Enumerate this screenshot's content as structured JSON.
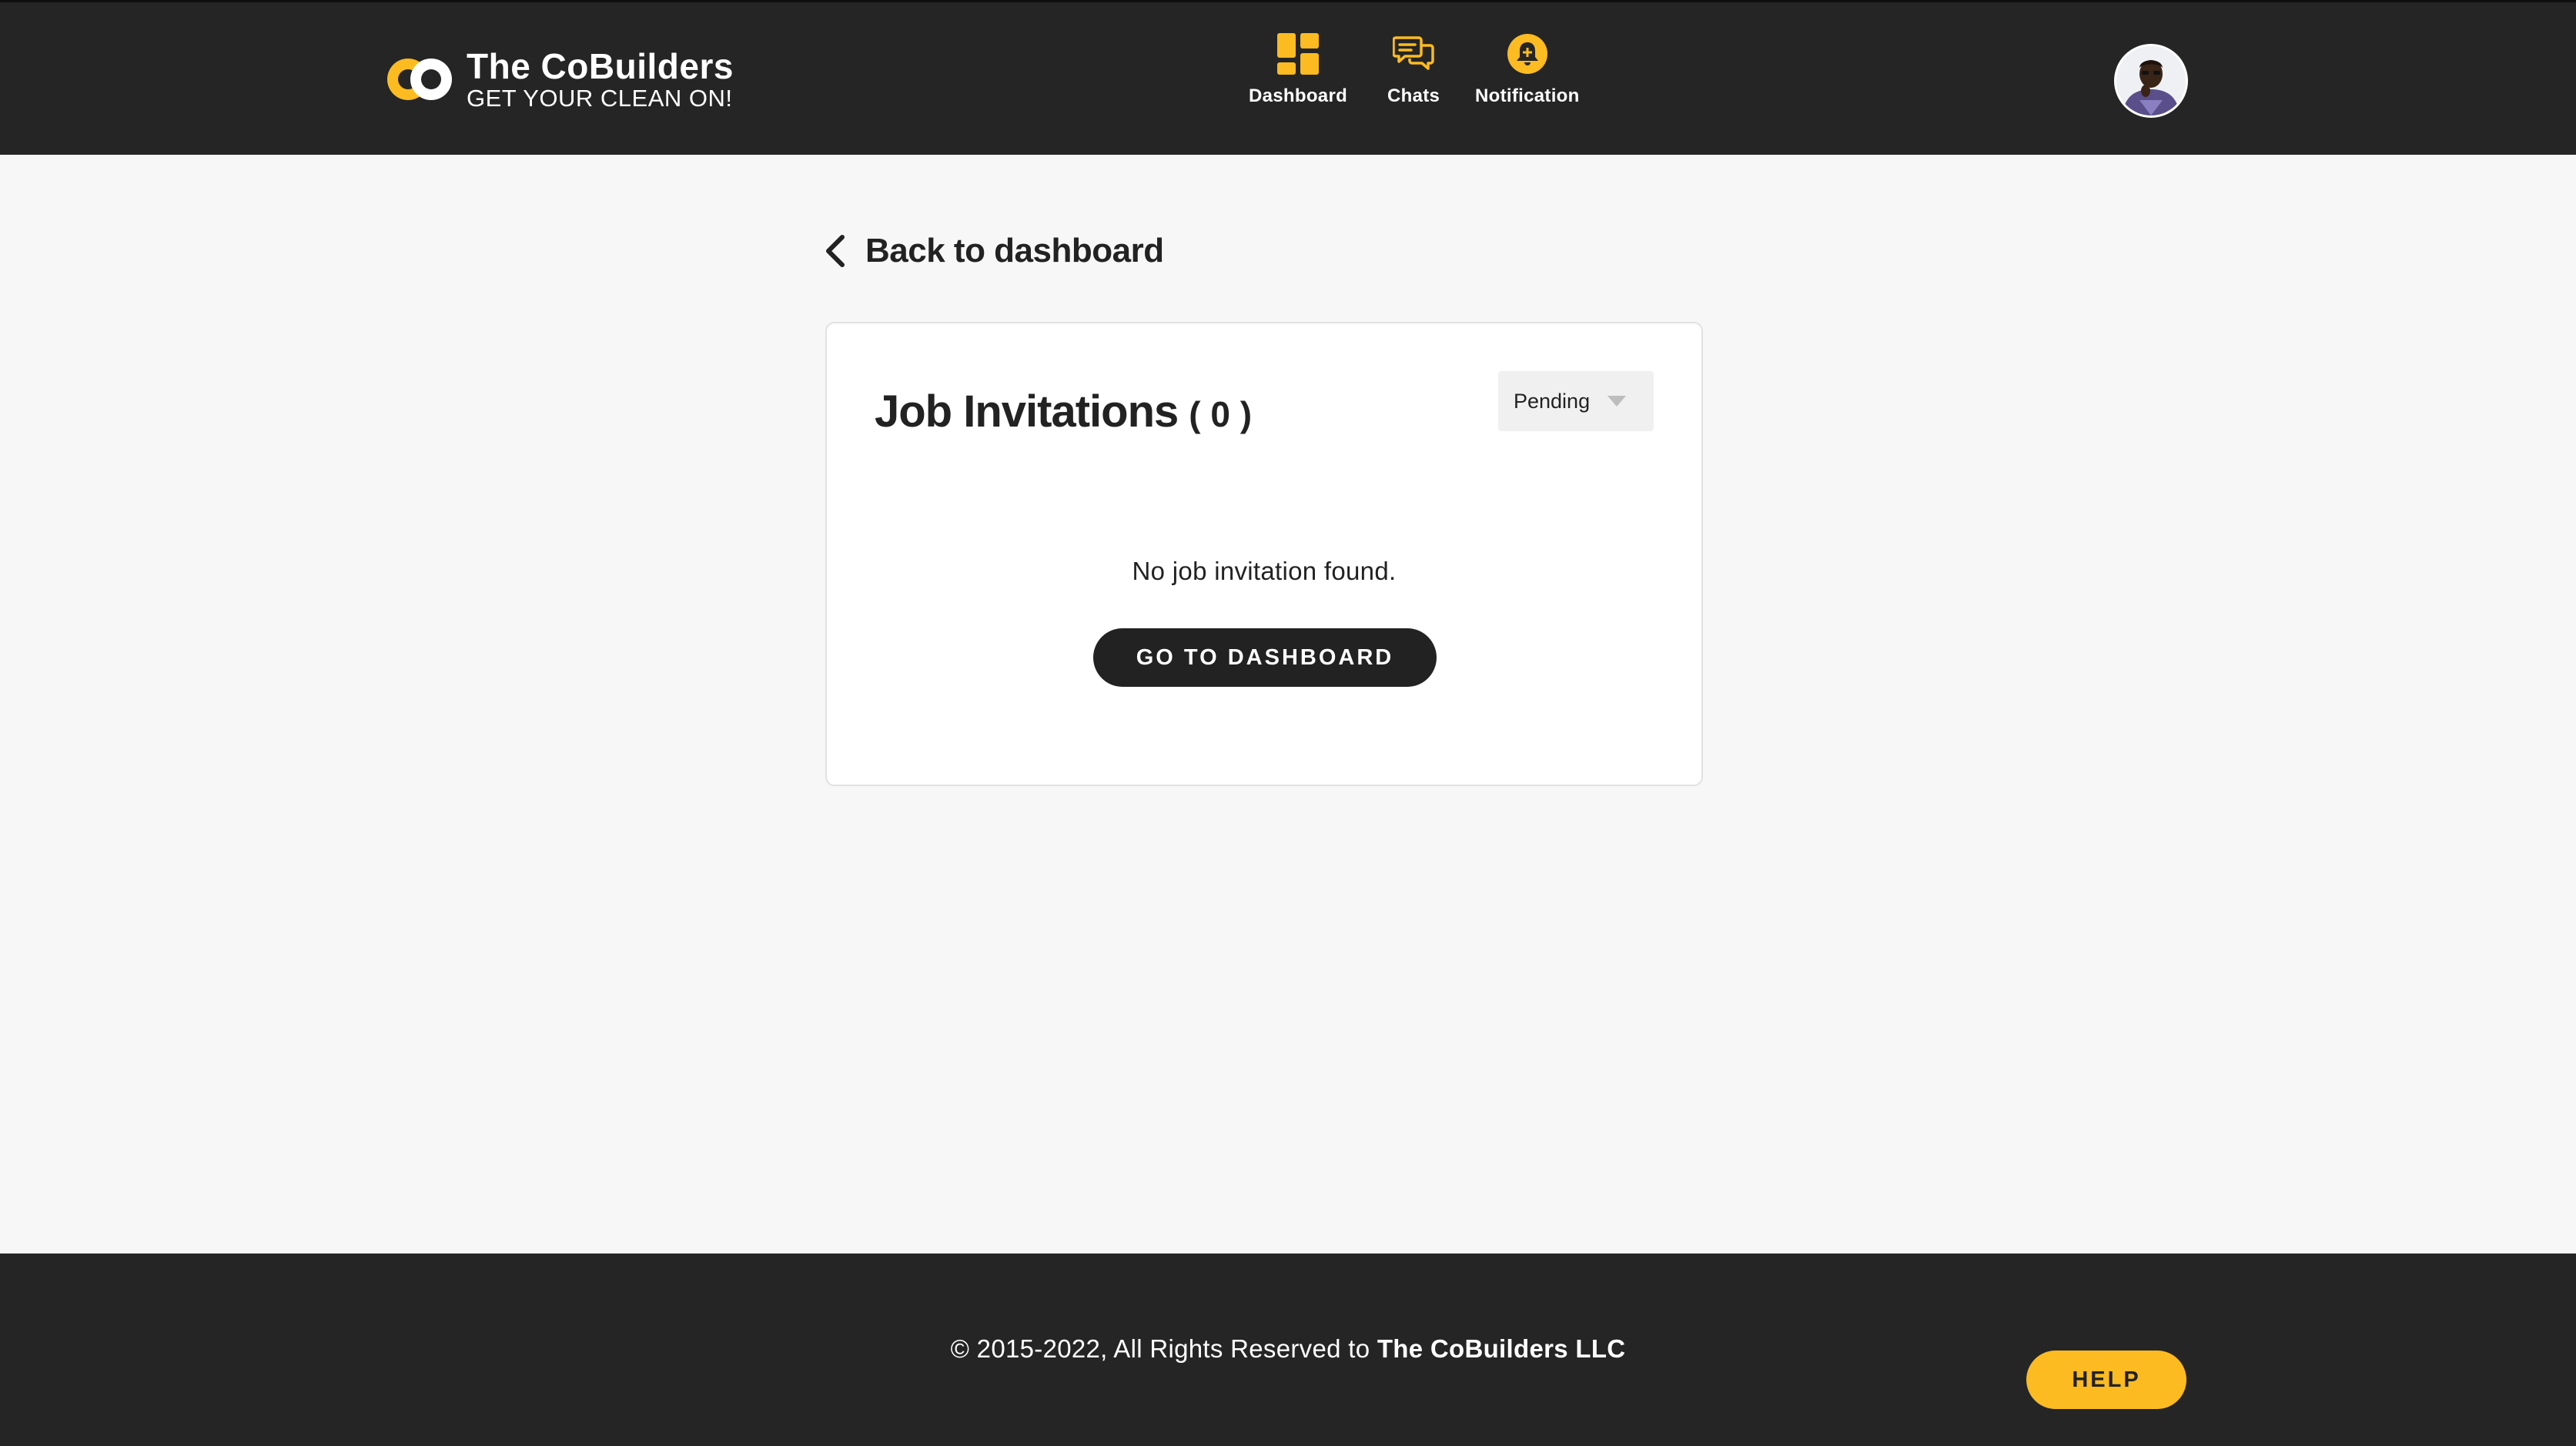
{
  "colors": {
    "accent": "#fbbb21",
    "header_bg": "#252525",
    "footer_bg": "#252525",
    "page_bg": "#f7f7f7",
    "card_bg": "#ffffff",
    "button_dark": "#222222",
    "text_dark": "#222222",
    "text_light": "#ffffff"
  },
  "header": {
    "brand": {
      "logo_icon": "cobuilders-logo",
      "name": "The CoBuilders",
      "tagline": "GET YOUR CLEAN ON!"
    },
    "nav": [
      {
        "label": "Dashboard",
        "icon": "dashboard-grid-icon"
      },
      {
        "label": "Chats",
        "icon": "chat-bubbles-icon"
      },
      {
        "label": "Notification",
        "icon": "bell-icon"
      }
    ],
    "avatar_icon": "user-avatar"
  },
  "main": {
    "back_link": {
      "label": "Back to dashboard",
      "icon": "chevron-left-icon"
    },
    "card": {
      "title": "Job Invitations",
      "count": "( 0 )",
      "filter": {
        "selected": "Pending",
        "icon": "caret-down-icon"
      },
      "empty_message": "No job invitation found.",
      "cta_label": "GO TO DASHBOARD"
    }
  },
  "footer": {
    "copyright_prefix": "© 2015-2022, All Rights Reserved to",
    "copyright_company": "The CoBuilders LLC",
    "help_label": "HELP"
  }
}
